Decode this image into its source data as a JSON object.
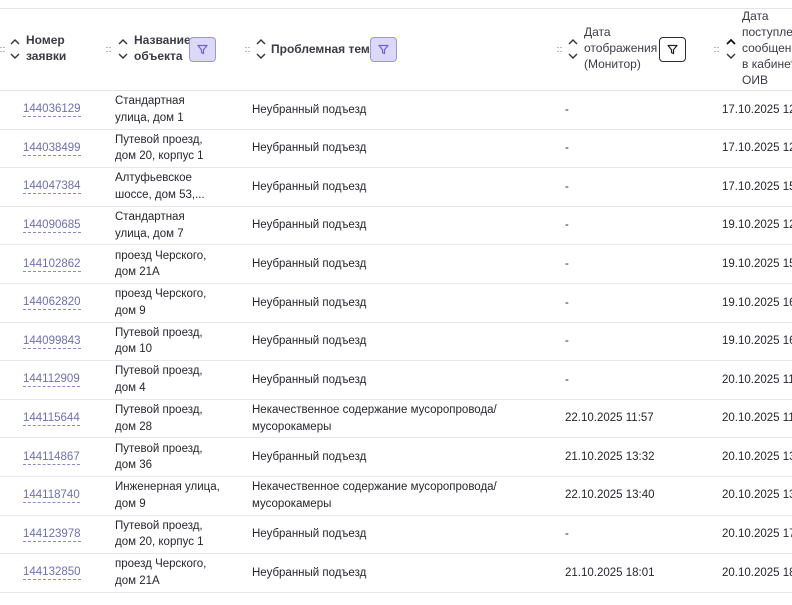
{
  "columns": {
    "number": "Номер\nзаявки",
    "object": "Название\nобъекта",
    "topic": "Проблемная тема",
    "display_date": "Дата\nотображения\n(Монитор)",
    "received_date": "Дата\nпоступлен\nсообщени\nв кабинет\nОИВ"
  },
  "rows": [
    {
      "id": "144036129",
      "object": "Стандартная\nулица, дом 1",
      "topic": "Неубранный подъезд",
      "display_date": "-",
      "received_date": "17.10.2025 12"
    },
    {
      "id": "144038499",
      "object": "Путевой проезд,\nдом 20, корпус 1",
      "topic": "Неубранный подъезд",
      "display_date": "-",
      "received_date": "17.10.2025 12"
    },
    {
      "id": "144047384",
      "object": "Алтуфьевское\nшоссе, дом 53,...",
      "topic": "Неубранный подъезд",
      "display_date": "-",
      "received_date": "17.10.2025 15"
    },
    {
      "id": "144090685",
      "object": "Стандартная\nулица, дом 7",
      "topic": "Неубранный подъезд",
      "display_date": "-",
      "received_date": "19.10.2025 12"
    },
    {
      "id": "144102862",
      "object": "проезд Черского,\nдом 21А",
      "topic": "Неубранный подъезд",
      "display_date": "-",
      "received_date": "19.10.2025 15"
    },
    {
      "id": "144062820",
      "object": "проезд Черского,\nдом 9",
      "topic": "Неубранный подъезд",
      "display_date": "-",
      "received_date": "19.10.2025 16"
    },
    {
      "id": "144099843",
      "object": "Путевой проезд,\nдом 10",
      "topic": "Неубранный подъезд",
      "display_date": "-",
      "received_date": "19.10.2025 16"
    },
    {
      "id": "144112909",
      "object": "Путевой проезд,\nдом 4",
      "topic": "Неубранный подъезд",
      "display_date": "-",
      "received_date": "20.10.2025 11"
    },
    {
      "id": "144115644",
      "object": "Путевой проезд,\nдом 28",
      "topic": "Некачественное содержание мусоропровода/\nмусорокамеры",
      "display_date": "22.10.2025 11:57",
      "received_date": "20.10.2025 11"
    },
    {
      "id": "144114867",
      "object": "Путевой проезд,\nдом 36",
      "topic": "Неубранный подъезд",
      "display_date": "21.10.2025 13:32",
      "received_date": "20.10.2025 13"
    },
    {
      "id": "144118740",
      "object": "Инженерная улица,\nдом 9",
      "topic": "Некачественное содержание мусоропровода/\nмусорокамеры",
      "display_date": "22.10.2025 13:40",
      "received_date": "20.10.2025 13"
    },
    {
      "id": "144123978",
      "object": "Путевой проезд,\nдом 20, корпус 1",
      "topic": "Неубранный подъезд",
      "display_date": "-",
      "received_date": "20.10.2025 17"
    },
    {
      "id": "144132850",
      "object": "проезд Черского,\nдом 21А",
      "topic": "Неубранный подъезд",
      "display_date": "21.10.2025 18:01",
      "received_date": "20.10.2025 18"
    }
  ],
  "icons": {
    "sort": "sort-arrows-icon",
    "filter": "funnel-filter-icon",
    "grip": "drag-grip-icon"
  },
  "colors": {
    "link": "#6f6fb0",
    "filter_active_bg": "#dcd8f7",
    "filter_active_border": "#9c94e6",
    "row_border": "#e8e8ec"
  }
}
